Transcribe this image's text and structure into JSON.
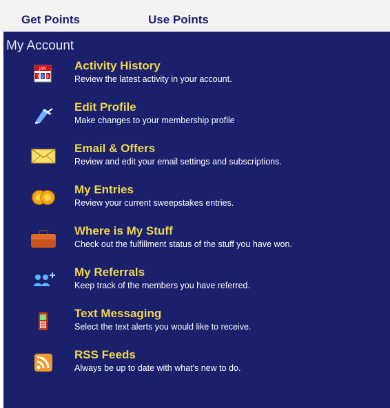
{
  "nav": {
    "get_points": "Get Points",
    "use_points": "Use Points"
  },
  "account": {
    "heading": "My Account",
    "items": [
      {
        "title": "Activity History",
        "desc": "Review the latest activity in your account.",
        "icon": "calendar-icon",
        "calendar_text": "JAN",
        "calendar_days": "1 2 3"
      },
      {
        "title": "Edit Profile",
        "desc": "Make changes to your membership profile",
        "icon": "pen-icon"
      },
      {
        "title": "Email & Offers",
        "desc": "Review and edit your email settings and subscriptions.",
        "icon": "envelope-icon"
      },
      {
        "title": "My Entries",
        "desc": "Review your current sweepstakes entries.",
        "icon": "coins-icon"
      },
      {
        "title": "Where is My Stuff",
        "desc": "Check out the fulfillment status of the stuff you have won.",
        "icon": "briefcase-icon"
      },
      {
        "title": "My Referrals",
        "desc": "Keep track of the members you have referred.",
        "icon": "add-users-icon"
      },
      {
        "title": "Text Messaging",
        "desc": "Select the text alerts you would like to receive.",
        "icon": "phone-icon"
      },
      {
        "title": "RSS Feeds",
        "desc": "Always be up to date with what's new to do.",
        "icon": "rss-icon"
      }
    ]
  },
  "colors": {
    "panel_bg": "#1a206b",
    "title": "#f0d74a",
    "desc": "#ffffff",
    "nav_text": "#1a2170"
  }
}
